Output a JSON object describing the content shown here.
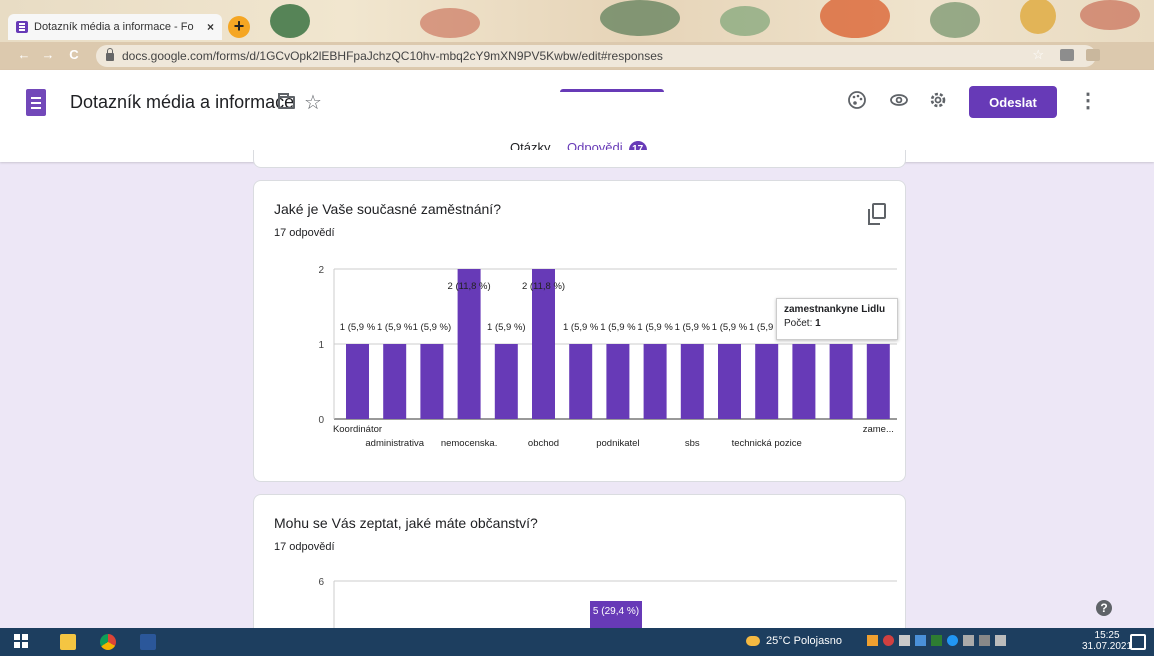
{
  "browser": {
    "tab_title": "Dotazník média a informace - Fo",
    "tab_close": "×",
    "new_tab": "+",
    "url": "docs.google.com/forms/d/1GCvOpk2lEBHFpaJchzQC10hv-mbq2cY9mXN9PV5Kwbw/edit#responses",
    "back": "←",
    "forward": "→",
    "reload": "C"
  },
  "header": {
    "title": "Dotazník média a informace",
    "send_label": "Odeslat",
    "star": "☆",
    "more": "⋮"
  },
  "tabs": [
    {
      "label": "Otázky"
    },
    {
      "label": "Odpovědi",
      "badge": "17"
    }
  ],
  "question1": {
    "title": "Jaké je Vaše současné zaměstnání?",
    "count": "17 odpovědí"
  },
  "question2": {
    "title": "Mohu se Vás zeptat, jaké máte občanství?",
    "count": "17 odpovědí"
  },
  "chart_data": [
    {
      "type": "bar",
      "ylim": [
        0,
        2
      ],
      "yticks": [
        "0",
        "1",
        "2"
      ],
      "values": [
        1,
        1,
        1,
        2,
        1,
        2,
        1,
        1,
        1,
        1,
        1,
        1,
        1,
        1,
        1
      ],
      "bar_labels": [
        "1 (5,9 %",
        "1 (5,9 %",
        "1 (5,9 %)",
        "2 (11,8 %)",
        "1 (5,9 %)",
        "2 (11,8 %)",
        "1 (5,9 %",
        "1 (5,9 %",
        "1 (5,9 %",
        "1 (5,9 %",
        "1 (5,9 %",
        "1 (5,9 %",
        "",
        "",
        ""
      ],
      "categories": [
        "Koordinátor",
        "administrativa",
        "",
        "nemocenska.",
        "",
        "obchod",
        "",
        "podnikatel",
        "",
        "sbs",
        "",
        "technická pozice",
        "",
        "",
        "zame..."
      ],
      "tooltip": {
        "title": "zamestnankyne Lidlu",
        "label": "Počet:",
        "value": "1"
      },
      "bar_color": "#673ab7"
    },
    {
      "type": "bar",
      "ylim": [
        0,
        6
      ],
      "yticks": [
        "6"
      ],
      "visible_bar_label": "5 (29,4 %)",
      "bar_color": "#673ab7"
    }
  ],
  "taskbar": {
    "weather": "25°C Polojasno",
    "time": "15:25",
    "date": "31.07.2021"
  },
  "colors": {
    "accent": "#673ab7",
    "page_bg": "#ede7f6",
    "taskbar": "#1d3e5f"
  }
}
